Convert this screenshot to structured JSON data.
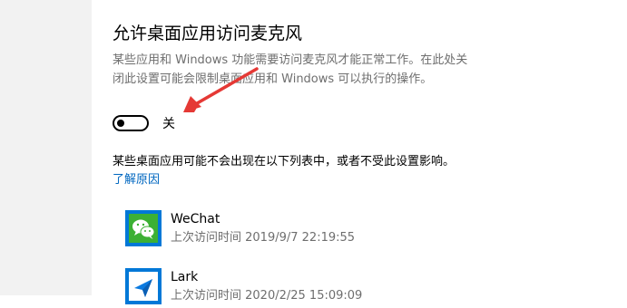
{
  "section": {
    "title": "允许桌面应用访问麦克风",
    "description_line1": "某些应用和 Windows 功能需要访问麦克风才能正常工作。在此处关",
    "description_line2": "闭此设置可能会限制桌面应用和 Windows 可以执行的操作。"
  },
  "toggle": {
    "state_label": "关",
    "is_on": false
  },
  "note": "某些桌面应用可能不会出现在以下列表中，或者不受此设置影响。",
  "link": "了解原因",
  "apps": [
    {
      "name": "WeChat",
      "last_access": "上次访问时间 2019/9/7 22:19:55",
      "icon": "wechat-icon"
    },
    {
      "name": "Lark",
      "last_access": "上次访问时间 2020/2/25 15:09:09",
      "icon": "lark-icon"
    }
  ],
  "colors": {
    "accent": "#0078d7",
    "link": "#0067c0",
    "annotation_arrow": "#e53935",
    "left_panel": "#f2f2f2"
  }
}
